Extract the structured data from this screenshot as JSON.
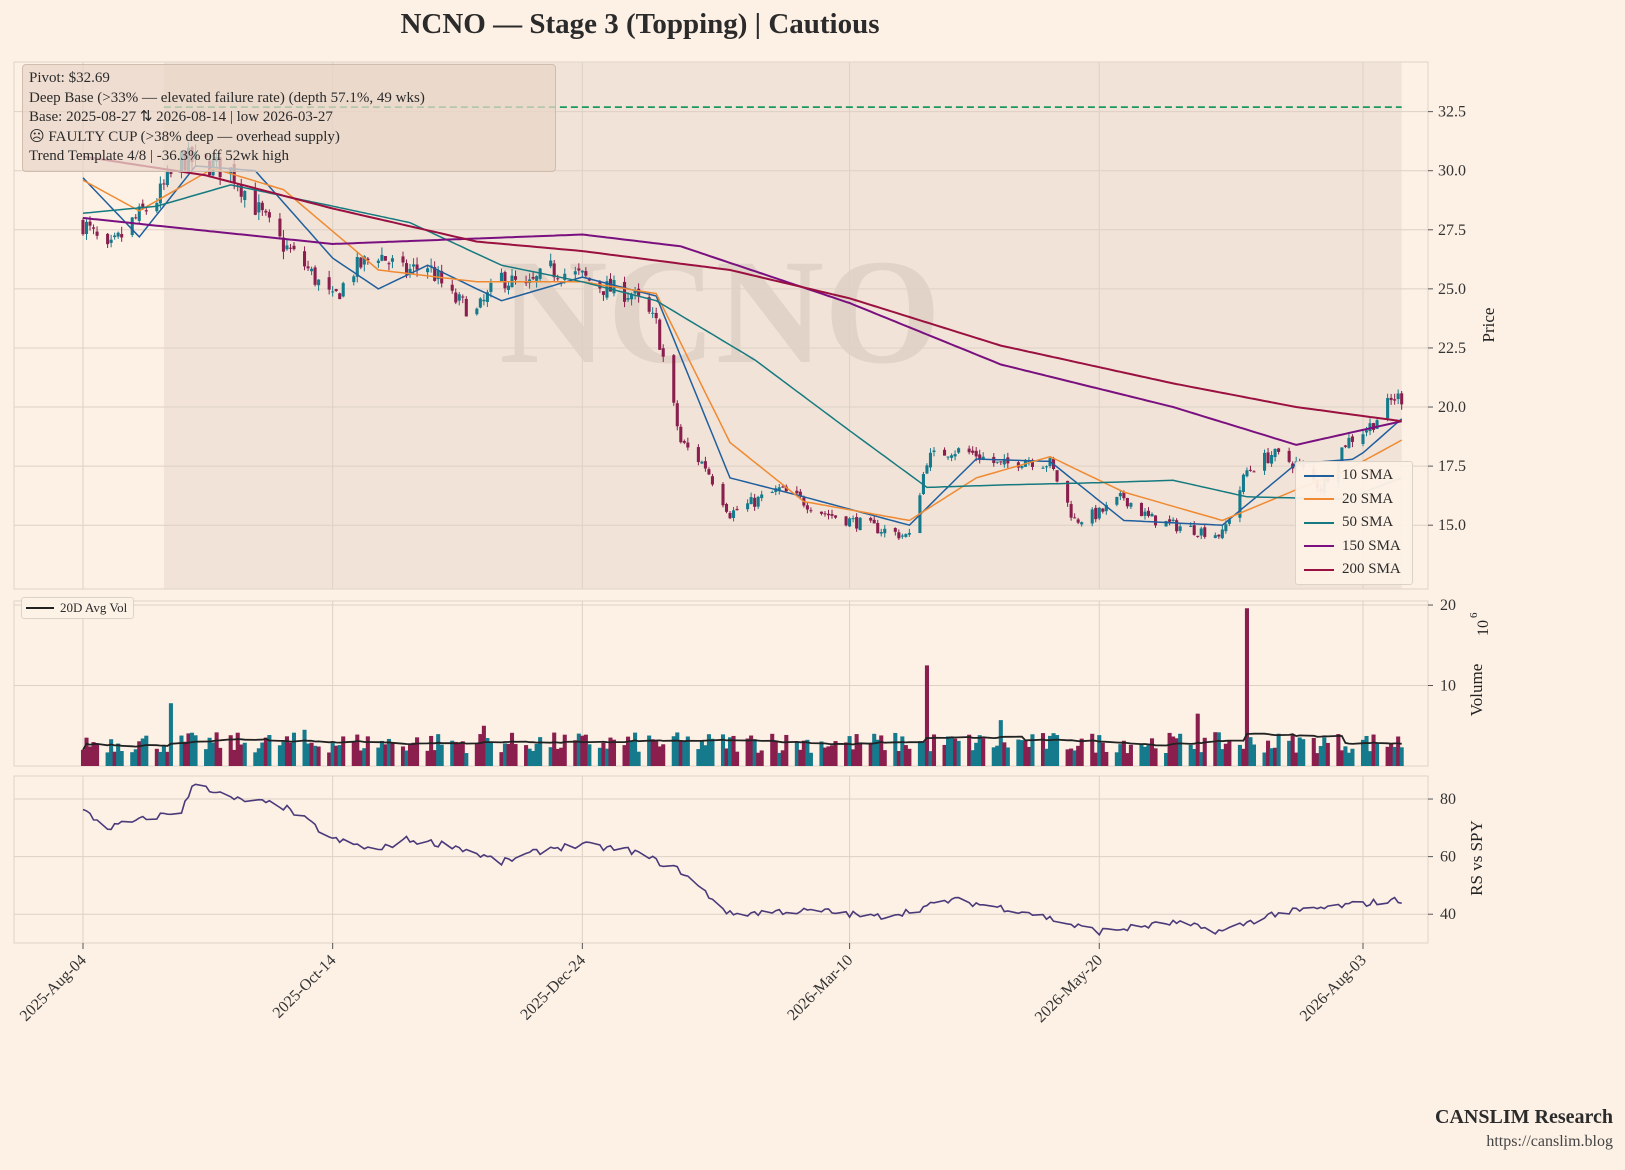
{
  "title": "NCNO  —  Stage 3 (Topping)  |  Cautious",
  "brand": {
    "name": "CANSLIM Research",
    "url": "https://canslim.blog"
  },
  "annotation": [
    "Pivot: $32.69",
    "Deep Base (>33% — elevated failure rate)  (depth 57.1%, 49 wks)",
    "Base: 2025-08-27 ⇅ 2026-08-14  |  low 2026-03-27",
    "☹ FAULTY CUP (>38% deep — overhead supply)",
    "Trend Template 4/8  |  -36.3% off 52wk high"
  ],
  "watermark": "NCNO",
  "colors": {
    "bg": "#fdf1e6",
    "up": "#157a8c",
    "down": "#8a1f4e",
    "pivot": "#1a9a5a",
    "rs": "#4b3a7a"
  },
  "legend": [
    {
      "label": "10 SMA",
      "color": "#1f5f9e"
    },
    {
      "label": "20 SMA",
      "color": "#f08a32"
    },
    {
      "label": "50 SMA",
      "color": "#157a80"
    },
    {
      "label": "150 SMA",
      "color": "#7a1080"
    },
    {
      "label": "200 SMA",
      "color": "#9a1040"
    }
  ],
  "volume_legend": "20D Avg Vol",
  "chart_data": {
    "type": "candlestick",
    "x_ticks": [
      "2025-Aug-04",
      "2025-Oct-14",
      "2025-Dec-24",
      "2026-Mar-10",
      "2026-May-20",
      "2026-Aug-03"
    ],
    "date_range": [
      "2025-08-04",
      "2026-08-14"
    ],
    "price_axis": {
      "label": "Price",
      "ylim": [
        12.3,
        34.6
      ],
      "ticks": [
        15.0,
        17.5,
        20.0,
        22.5,
        25.0,
        27.5,
        30.0,
        32.5
      ]
    },
    "volume_axis": {
      "label": "Volume",
      "multiplier": "10^6",
      "ylim": [
        0,
        20.5
      ],
      "ticks": [
        10,
        20
      ]
    },
    "rs_axis": {
      "label": "RS vs SPY",
      "ylim": [
        30,
        88
      ],
      "ticks": [
        40,
        60,
        80
      ]
    },
    "pivot": 32.69,
    "base_shading": [
      "2025-08-27",
      "2026-08-14"
    ],
    "close_anchors": [
      [
        "2025-08-04",
        27.8
      ],
      [
        "2025-08-11",
        26.5
      ],
      [
        "2025-08-18",
        27.8
      ],
      [
        "2025-08-25",
        28.8
      ],
      [
        "2025-09-01",
        30.5
      ],
      [
        "2025-09-08",
        30.3
      ],
      [
        "2025-09-15",
        30.0
      ],
      [
        "2025-09-22",
        28.5
      ],
      [
        "2025-09-29",
        27.0
      ],
      [
        "2025-10-06",
        26.0
      ],
      [
        "2025-10-14",
        24.5
      ],
      [
        "2025-10-20",
        25.8
      ],
      [
        "2025-10-27",
        26.5
      ],
      [
        "2025-11-03",
        25.7
      ],
      [
        "2025-11-10",
        26.0
      ],
      [
        "2025-11-17",
        24.6
      ],
      [
        "2025-11-24",
        24.0
      ],
      [
        "2025-12-01",
        25.5
      ],
      [
        "2025-12-08",
        25.0
      ],
      [
        "2025-12-15",
        25.8
      ],
      [
        "2025-12-24",
        25.5
      ],
      [
        "2025-12-31",
        25.0
      ],
      [
        "2026-01-07",
        24.8
      ],
      [
        "2026-01-14",
        23.5
      ],
      [
        "2026-01-21",
        18.5
      ],
      [
        "2026-01-28",
        17.5
      ],
      [
        "2026-02-04",
        15.5
      ],
      [
        "2026-02-11",
        16.0
      ],
      [
        "2026-02-18",
        16.5
      ],
      [
        "2026-02-25",
        16.0
      ],
      [
        "2026-03-03",
        15.5
      ],
      [
        "2026-03-10",
        15.2
      ],
      [
        "2026-03-17",
        14.9
      ],
      [
        "2026-03-27",
        14.5
      ],
      [
        "2026-04-01",
        17.8
      ],
      [
        "2026-04-08",
        18.2
      ],
      [
        "2026-04-15",
        18.0
      ],
      [
        "2026-04-22",
        17.5
      ],
      [
        "2026-04-29",
        17.8
      ],
      [
        "2026-05-06",
        17.6
      ],
      [
        "2026-05-13",
        15.2
      ],
      [
        "2026-05-20",
        15.5
      ],
      [
        "2026-05-27",
        16.2
      ],
      [
        "2026-06-03",
        15.3
      ],
      [
        "2026-06-10",
        15.0
      ],
      [
        "2026-06-17",
        14.8
      ],
      [
        "2026-06-24",
        14.6
      ],
      [
        "2026-07-01",
        17.3
      ],
      [
        "2026-07-08",
        18.0
      ],
      [
        "2026-07-15",
        17.6
      ],
      [
        "2026-07-22",
        16.6
      ],
      [
        "2026-07-29",
        18.5
      ],
      [
        "2026-08-05",
        19.2
      ],
      [
        "2026-08-12",
        20.4
      ]
    ],
    "sma_anchors": {
      "10 SMA": [
        [
          "2025-08-04",
          29.7
        ],
        [
          "2025-08-20",
          27.2
        ],
        [
          "2025-09-05",
          30.2
        ],
        [
          "2025-09-22",
          30.0
        ],
        [
          "2025-10-14",
          26.3
        ],
        [
          "2025-10-27",
          25.0
        ],
        [
          "2025-11-10",
          26.0
        ],
        [
          "2025-12-01",
          24.5
        ],
        [
          "2025-12-24",
          25.5
        ],
        [
          "2026-01-14",
          24.7
        ],
        [
          "2026-02-04",
          17.0
        ],
        [
          "2026-02-25",
          16.2
        ],
        [
          "2026-03-27",
          15.0
        ],
        [
          "2026-04-15",
          17.8
        ],
        [
          "2026-05-06",
          17.7
        ],
        [
          "2026-05-27",
          15.2
        ],
        [
          "2026-06-24",
          15.0
        ],
        [
          "2026-07-15",
          17.6
        ],
        [
          "2026-08-01",
          17.8
        ],
        [
          "2026-08-14",
          19.5
        ]
      ],
      "20 SMA": [
        [
          "2025-08-04",
          29.6
        ],
        [
          "2025-08-20",
          28.3
        ],
        [
          "2025-09-10",
          30.1
        ],
        [
          "2025-09-30",
          29.2
        ],
        [
          "2025-10-27",
          25.8
        ],
        [
          "2025-11-24",
          25.3
        ],
        [
          "2025-12-24",
          25.3
        ],
        [
          "2026-01-14",
          24.8
        ],
        [
          "2026-02-04",
          18.5
        ],
        [
          "2026-02-25",
          16.0
        ],
        [
          "2026-03-27",
          15.2
        ],
        [
          "2026-04-15",
          17.0
        ],
        [
          "2026-05-06",
          17.9
        ],
        [
          "2026-05-27",
          16.4
        ],
        [
          "2026-06-24",
          15.2
        ],
        [
          "2026-07-15",
          16.5
        ],
        [
          "2026-07-29",
          17.3
        ],
        [
          "2026-08-14",
          18.6
        ]
      ],
      "50 SMA": [
        [
          "2025-08-04",
          28.2
        ],
        [
          "2025-08-25",
          28.5
        ],
        [
          "2025-09-15",
          29.4
        ],
        [
          "2025-10-14",
          28.5
        ],
        [
          "2025-11-05",
          27.8
        ],
        [
          "2025-12-01",
          26.0
        ],
        [
          "2025-12-24",
          25.3
        ],
        [
          "2026-01-14",
          24.5
        ],
        [
          "2026-02-11",
          22.0
        ],
        [
          "2026-03-10",
          19.0
        ],
        [
          "2026-04-01",
          16.6
        ],
        [
          "2026-04-22",
          16.7
        ],
        [
          "2026-05-20",
          16.8
        ],
        [
          "2026-06-10",
          16.9
        ],
        [
          "2026-07-01",
          16.2
        ],
        [
          "2026-07-29",
          16.1
        ],
        [
          "2026-08-14",
          17.0
        ]
      ],
      "150 SMA": [
        [
          "2025-08-04",
          28.0
        ],
        [
          "2025-10-14",
          26.9
        ],
        [
          "2025-12-24",
          27.3
        ],
        [
          "2026-01-21",
          26.8
        ],
        [
          "2026-03-10",
          24.4
        ],
        [
          "2026-04-22",
          21.8
        ],
        [
          "2026-06-10",
          20.0
        ],
        [
          "2026-07-15",
          18.4
        ],
        [
          "2026-08-14",
          19.4
        ]
      ],
      "200 SMA": [
        [
          "2025-08-04",
          30.6
        ],
        [
          "2025-09-08",
          29.8
        ],
        [
          "2025-10-14",
          28.4
        ],
        [
          "2025-11-24",
          27.0
        ],
        [
          "2025-12-24",
          26.6
        ],
        [
          "2026-02-04",
          25.8
        ],
        [
          "2026-03-10",
          24.6
        ],
        [
          "2026-04-22",
          22.6
        ],
        [
          "2026-06-10",
          21.0
        ],
        [
          "2026-07-15",
          20.0
        ],
        [
          "2026-08-14",
          19.4
        ]
      ]
    },
    "volume_spikes_millions": [
      [
        "2025-08-29",
        7.8
      ],
      [
        "2025-10-06",
        4.5
      ],
      [
        "2025-11-26",
        5.0
      ],
      [
        "2026-02-16",
        4.0
      ],
      [
        "2026-04-01",
        12.5
      ],
      [
        "2026-04-22",
        5.7
      ],
      [
        "2026-05-30",
        7.5
      ],
      [
        "2026-06-17",
        6.5
      ],
      [
        "2026-07-01",
        19.6
      ]
    ],
    "rs_anchors": [
      [
        "2025-08-04",
        76
      ],
      [
        "2025-08-11",
        70
      ],
      [
        "2025-08-25",
        74
      ],
      [
        "2025-09-01",
        76
      ],
      [
        "2025-09-05",
        86
      ],
      [
        "2025-09-15",
        80
      ],
      [
        "2025-09-29",
        78
      ],
      [
        "2025-10-06",
        73
      ],
      [
        "2025-10-14",
        66
      ],
      [
        "2025-10-27",
        62
      ],
      [
        "2025-11-03",
        66
      ],
      [
        "2025-11-17",
        64
      ],
      [
        "2025-12-01",
        58
      ],
      [
        "2025-12-15",
        63
      ],
      [
        "2025-12-24",
        64
      ],
      [
        "2026-01-07",
        62
      ],
      [
        "2026-01-21",
        55
      ],
      [
        "2026-02-04",
        40
      ],
      [
        "2026-02-18",
        41
      ],
      [
        "2026-03-03",
        41
      ],
      [
        "2026-03-17",
        39
      ],
      [
        "2026-03-27",
        41
      ],
      [
        "2026-04-08",
        45
      ],
      [
        "2026-04-29",
        41
      ],
      [
        "2026-05-13",
        36
      ],
      [
        "2026-05-20",
        34
      ],
      [
        "2026-06-10",
        37
      ],
      [
        "2026-06-24",
        34
      ],
      [
        "2026-07-08",
        40
      ],
      [
        "2026-07-22",
        42
      ],
      [
        "2026-08-05",
        44
      ],
      [
        "2026-08-14",
        45
      ]
    ]
  }
}
